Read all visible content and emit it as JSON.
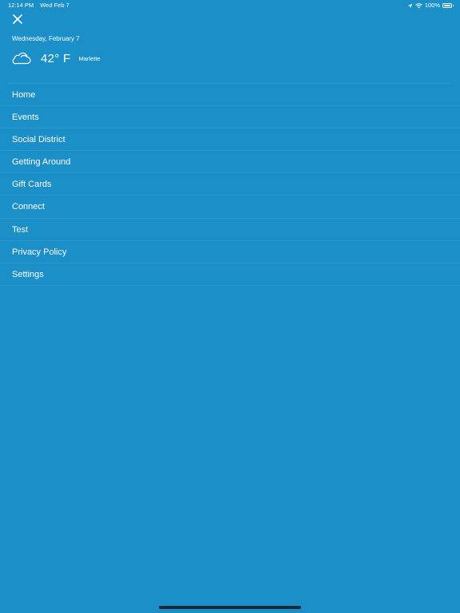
{
  "status_bar": {
    "time": "12:14 PM",
    "date": "Wed Feb 7",
    "battery": "100%",
    "battery_level": 1.0
  },
  "header": {
    "date": "Wednesday, February 7",
    "weather": {
      "icon": "cloud-icon",
      "temperature": "42° F",
      "location": "Marlette"
    }
  },
  "menu": {
    "items": [
      {
        "label": "Home"
      },
      {
        "label": "Events"
      },
      {
        "label": "Social District"
      },
      {
        "label": "Getting Around"
      },
      {
        "label": "Gift Cards"
      },
      {
        "label": "Connect"
      },
      {
        "label": "Test"
      },
      {
        "label": "Privacy Policy"
      },
      {
        "label": "Settings"
      }
    ]
  },
  "colors": {
    "background": "#1b90c8",
    "text": "#ffffff"
  }
}
